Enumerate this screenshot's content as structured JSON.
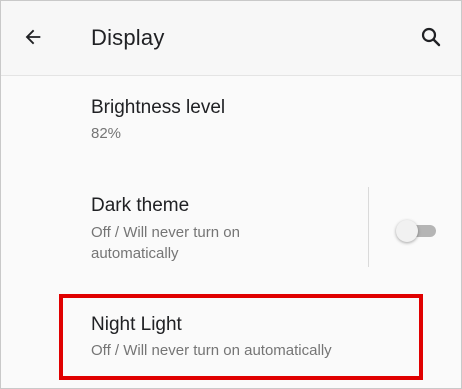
{
  "app_bar": {
    "title": "Display",
    "back_icon": "arrow-back-icon",
    "search_icon": "search-icon"
  },
  "settings": [
    {
      "title": "Brightness level",
      "summary": "82%"
    },
    {
      "title": "Dark theme",
      "summary": "Off / Will never turn on automatically",
      "toggle": {
        "state": "off"
      }
    },
    {
      "title": "Night Light",
      "summary": "Off / Will never turn on automatically"
    }
  ],
  "colors": {
    "highlight_border": "#e00000",
    "title_text": "#202124",
    "summary_text": "#757575"
  }
}
